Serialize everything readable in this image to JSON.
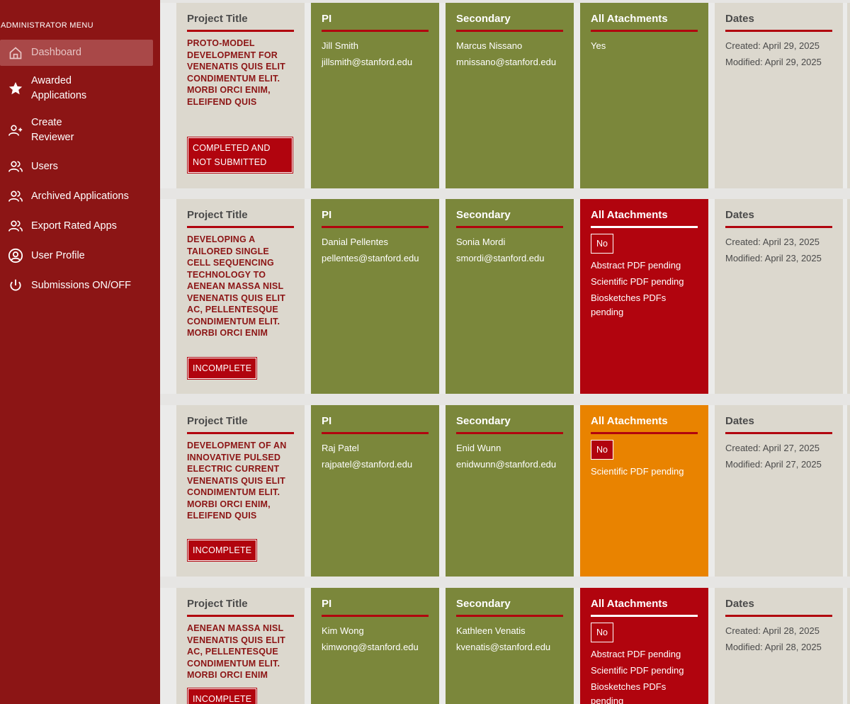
{
  "sidebar": {
    "menu_title": "ADMINISTRATOR MENU",
    "items": [
      {
        "label": "Dashboard",
        "icon": "home-icon"
      },
      {
        "label": "Awarded Applications",
        "icon": "star-icon"
      },
      {
        "label": "Create Reviewer",
        "icon": "add-user-icon"
      },
      {
        "label": "Users",
        "icon": "users-icon"
      },
      {
        "label": "Archived Applications",
        "icon": "users-icon"
      },
      {
        "label": "Export Rated Apps",
        "icon": "users-icon"
      },
      {
        "label": "User Profile",
        "icon": "user-circle-icon"
      },
      {
        "label": "Submissions ON/OFF",
        "icon": "power-icon"
      }
    ]
  },
  "headers": {
    "project_title": "Project Title",
    "pi": "PI",
    "secondary": "Secondary",
    "attachments": "All Atachments",
    "dates": "Dates"
  },
  "applications": [
    {
      "title": "PROTO-MODEL DEVELOPMENT FOR VENENATIS QUIS ELIT CONDIMENTUM ELIT. MORBI ORCI ENIM, ELEIFEND QUIS",
      "status": "COMPLETED AND NOT SUBMITTED",
      "pi_name": "Jill Smith",
      "pi_email": "jillsmith@stanford.edu",
      "sec_name": "Marcus Nissano",
      "sec_email": "mnissano@stanford.edu",
      "attachments": "Yes",
      "created": "Created: April 29, 2025",
      "modified": "Modified: April 29, 2025"
    },
    {
      "title": "DEVELOPING A TAILORED SINGLE CELL SEQUENCING TECHNOLOGY TO AENEAN MASSA NISL VENENATIS QUIS ELIT AC, PELLENTESQUE CONDIMENTUM ELIT. MORBI ORCI ENIM",
      "status": "INCOMPLETE",
      "pi_name": "Danial Pellentes",
      "pi_email": "pellentes@stanford.edu",
      "sec_name": "Sonia Mordi",
      "sec_email": "smordi@stanford.edu",
      "attachments": "No",
      "pending": [
        "Abstract PDF pending",
        "Scientific PDF pending",
        "Biosketches PDFs pending"
      ],
      "created": "Created: April 23, 2025",
      "modified": "Modified: April 23, 2025"
    },
    {
      "title": "DEVELOPMENT OF AN INNOVATIVE PULSED ELECTRIC CURRENT VENENATIS QUIS ELIT CONDIMENTUM ELIT. MORBI ORCI ENIM, ELEIFEND QUIS",
      "status": "INCOMPLETE",
      "pi_name": "Raj Patel",
      "pi_email": "rajpatel@stanford.edu",
      "sec_name": "Enid Wunn",
      "sec_email": "enidwunn@stanford.edu",
      "attachments": "No",
      "pending": [
        "Scientific PDF pending"
      ],
      "created": "Created: April 27, 2025",
      "modified": "Modified: April 27, 2025"
    },
    {
      "title": "AENEAN MASSA NISL VENENATIS QUIS ELIT AC, PELLENTESQUE CONDIMENTUM ELIT. MORBI ORCI ENIM",
      "status": "INCOMPLETE",
      "pi_name": "Kim Wong",
      "pi_email": "kimwong@stanford.edu",
      "sec_name": "Kathleen Venatis",
      "sec_email": "kvenatis@stanford.edu",
      "attachments": "No",
      "pending": [
        "Abstract PDF pending",
        "Scientific PDF pending",
        "Biosketches PDFs pending"
      ],
      "created": "Created: April 28, 2025",
      "modified": "Modified: April 28, 2025"
    }
  ],
  "colors": {
    "sidebar": "#8c1515",
    "status_red": "#b1040e",
    "olive": "#7b873b",
    "orange": "#e98300",
    "sand": "#dcd8ce"
  }
}
